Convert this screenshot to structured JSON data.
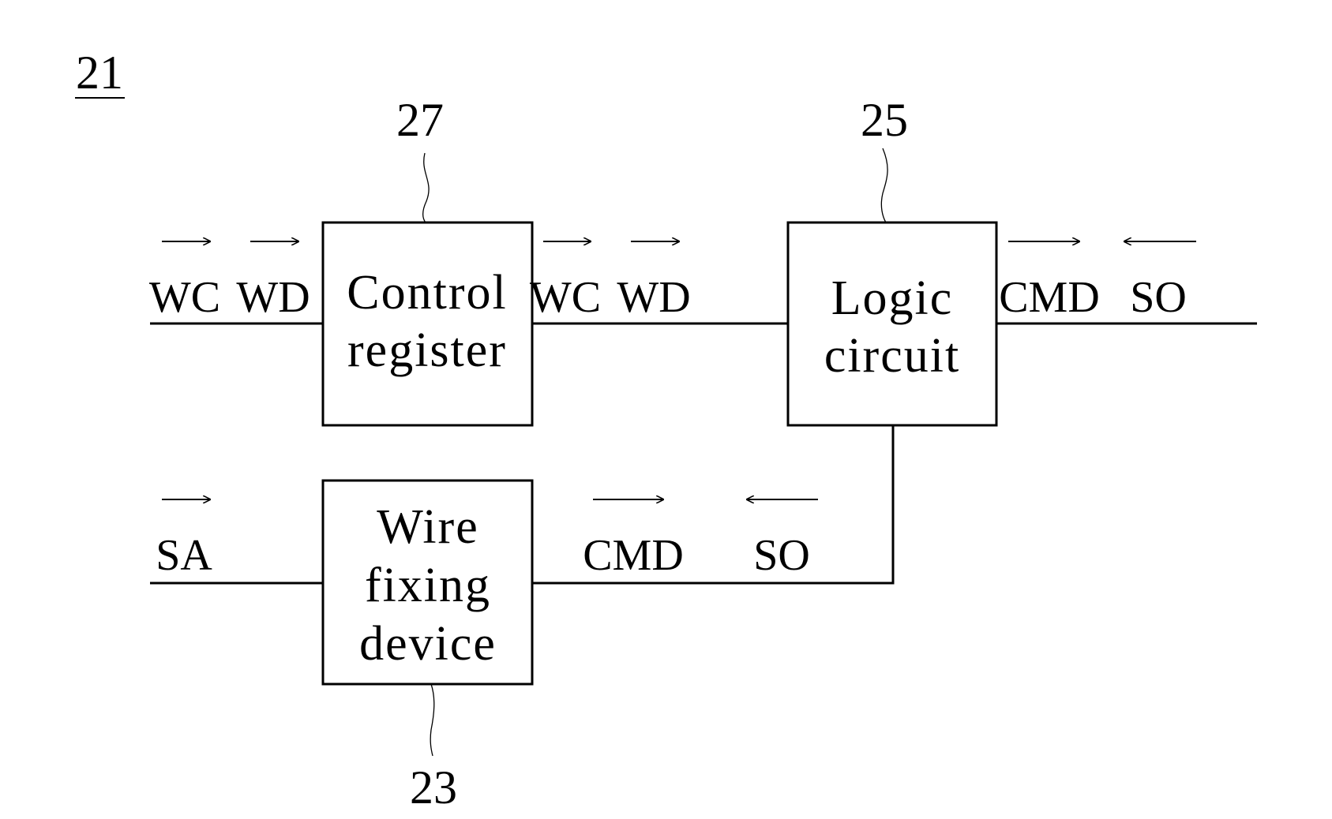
{
  "figure": {
    "id_label": "21",
    "blocks": [
      {
        "ref": "27",
        "lines": [
          "Control",
          "register"
        ]
      },
      {
        "ref": "25",
        "lines": [
          "Logic",
          "circuit"
        ]
      },
      {
        "ref": "23",
        "lines": [
          "Wire",
          "fixing",
          "device"
        ]
      }
    ],
    "signals": {
      "top_left": [
        {
          "label": "WC",
          "direction": "right"
        },
        {
          "label": "WD",
          "direction": "right"
        }
      ],
      "top_middle": [
        {
          "label": "WC",
          "direction": "right"
        },
        {
          "label": "WD",
          "direction": "right"
        }
      ],
      "top_right": [
        {
          "label": "CMD",
          "direction": "right"
        },
        {
          "label": "SO",
          "direction": "left"
        }
      ],
      "bottom_left": [
        {
          "label": "SA",
          "direction": "right"
        }
      ],
      "bottom_middle": [
        {
          "label": "CMD",
          "direction": "right"
        },
        {
          "label": "SO",
          "direction": "left"
        }
      ]
    }
  }
}
